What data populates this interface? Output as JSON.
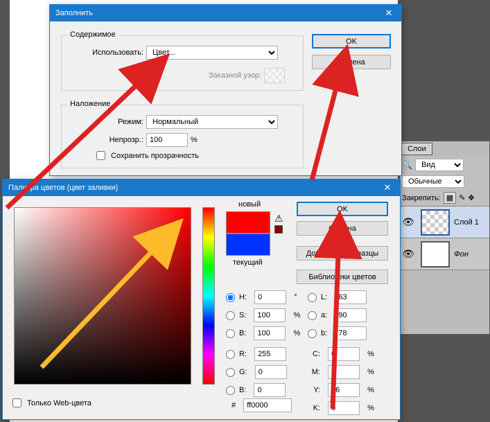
{
  "fillDialog": {
    "title": "Заполнить",
    "content": {
      "group": "Содержимое",
      "useLabel": "Использовать:",
      "useValue": "Цвет...",
      "patternLabel": "Заказной узор:"
    },
    "blend": {
      "group": "Наложение",
      "modeLabel": "Режим:",
      "modeValue": "Нормальный",
      "opacityLabel": "Непрозр.:",
      "opacityValue": "100",
      "percent": "%",
      "preserve": "Сохранить прозрачность"
    },
    "ok": "OK",
    "cancel": "Отмена"
  },
  "colorDialog": {
    "title": "Палитра цветов (цвет заливки)",
    "new": "новый",
    "current": "текущий",
    "ok": "OK",
    "cancel": "Отмена",
    "addSwatch": "Добавить в образцы",
    "colorLibs": "Библиотеки цветов",
    "webOnly": "Только Web-цвета",
    "hashLabel": "#",
    "hex": "ff0000",
    "H": "H:",
    "Hv": "0",
    "Hdeg": "°",
    "S": "S:",
    "Sv": "100",
    "Bh": "B:",
    "Bhv": "100",
    "R": "R:",
    "Rv": "255",
    "G": "G:",
    "Gv": "0",
    "Br": "B:",
    "Brv": "0",
    "L": "L:",
    "Lv": "63",
    "a": "a:",
    "av": "90",
    "b": "b:",
    "bv": "78",
    "C": "C:",
    "Cv": "0",
    "M": "M:",
    "Mv": "0",
    "Y": "Y:",
    "Yv": "96",
    "K": "K:",
    "Kv": "0",
    "pct": "%",
    "colors": {
      "new": "#ff0000",
      "current": "#0033ff"
    }
  },
  "layersPanel": {
    "tab": "Слои",
    "kind": "Вид",
    "blendMode": "Обычные",
    "lock": "Закрепить:",
    "layer1": "Слой 1",
    "bg": "Фон"
  }
}
